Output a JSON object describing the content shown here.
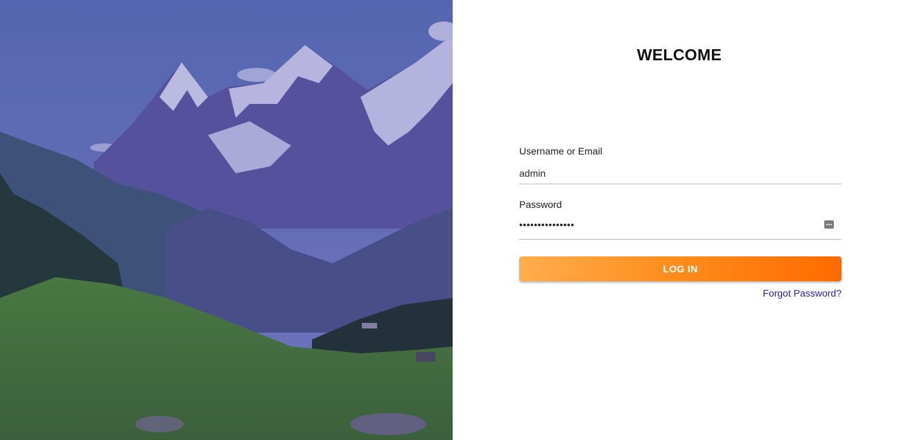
{
  "hero": {
    "image": "mountain-landscape",
    "overlay_color": "#3b2f9a"
  },
  "login": {
    "title": "WELCOME",
    "username_label": "Username or Email",
    "username_value": "admin",
    "password_label": "Password",
    "password_mask": "•••••••••••••••",
    "password_toggle_icon": "password-dots-icon",
    "button_label": "LOG IN",
    "forgot_link": "Forgot Password?"
  },
  "colors": {
    "button_start": "#ffad4f",
    "button_end": "#ff6a00",
    "link": "#2b1bb0"
  }
}
